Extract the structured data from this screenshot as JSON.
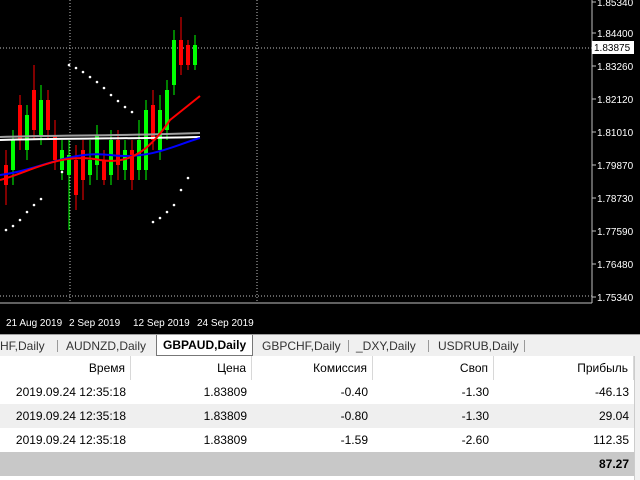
{
  "chart": {
    "symbol": "GBPAUD,Daily",
    "current_price_label": "1.83875",
    "price_axis": [
      "1.85340",
      "1.84400",
      "1.83260",
      "1.82120",
      "1.81010",
      "1.79870",
      "1.78730",
      "1.77590",
      "1.76480",
      "1.75340"
    ],
    "date_axis": [
      "21 Aug 2019",
      "2 Sep 2019",
      "12 Sep 2019",
      "24 Sep 2019"
    ],
    "colors": {
      "bull_candle": "#00ff00",
      "bear_candle": "#ff0000",
      "ma_fast": "#ff0000",
      "ma_slow": "#0000ff",
      "ma_white": "#ffffff",
      "ma_gray": "#a0a0a0",
      "grid": "#c0c0c0",
      "sar_dots": "#ffffff"
    }
  },
  "tabs": [
    {
      "label": "HF,Daily"
    },
    {
      "label": "AUDNZD,Daily"
    },
    {
      "label": "GBPAUD,Daily",
      "active": true
    },
    {
      "label": "GBPCHF,Daily"
    },
    {
      "label": "_DXY,Daily"
    },
    {
      "label": "USDRUB,Daily"
    }
  ],
  "table": {
    "headers": [
      "Время",
      "Цена",
      "Комиссия",
      "Своп",
      "Прибыль"
    ],
    "rows": [
      [
        "2019.09.24 12:35:18",
        "1.83809",
        "-0.40",
        "-1.30",
        "-46.13"
      ],
      [
        "2019.09.24 12:35:18",
        "1.83809",
        "-0.80",
        "-1.30",
        "29.04"
      ],
      [
        "2019.09.24 12:35:18",
        "1.83809",
        "-1.59",
        "-2.60",
        "112.35"
      ]
    ],
    "total": "87.27"
  }
}
